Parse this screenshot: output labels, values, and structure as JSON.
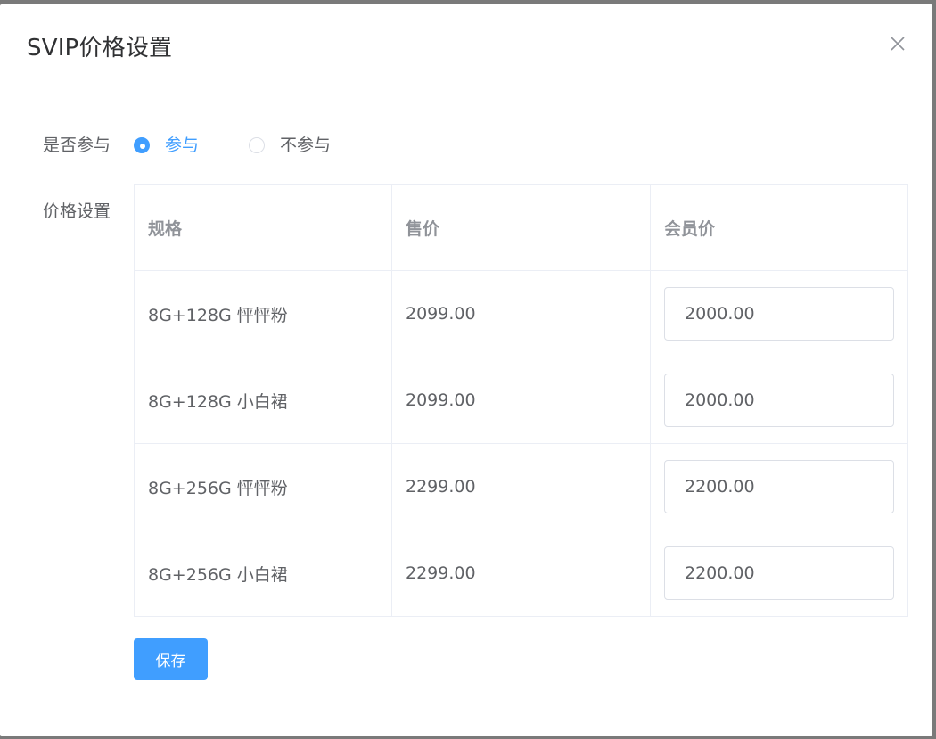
{
  "dialog": {
    "title": "SVIP价格设置",
    "close_icon": "close-icon"
  },
  "participate": {
    "label": "是否参与",
    "options": [
      {
        "label": "参与",
        "checked": true
      },
      {
        "label": "不参与",
        "checked": false
      }
    ]
  },
  "pricing": {
    "label": "价格设置",
    "columns": [
      "规格",
      "售价",
      "会员价"
    ],
    "rows": [
      {
        "spec": "8G+128G 怦怦粉",
        "price": "2099.00",
        "member_price": "2000.00"
      },
      {
        "spec": "8G+128G 小白裙",
        "price": "2099.00",
        "member_price": "2000.00"
      },
      {
        "spec": "8G+256G 怦怦粉",
        "price": "2299.00",
        "member_price": "2200.00"
      },
      {
        "spec": "8G+256G 小白裙",
        "price": "2299.00",
        "member_price": "2200.00"
      }
    ]
  },
  "actions": {
    "save_label": "保存"
  },
  "colors": {
    "primary": "#409eff",
    "text": "#606266",
    "header_text": "#909399",
    "border": "#ebeef5"
  }
}
